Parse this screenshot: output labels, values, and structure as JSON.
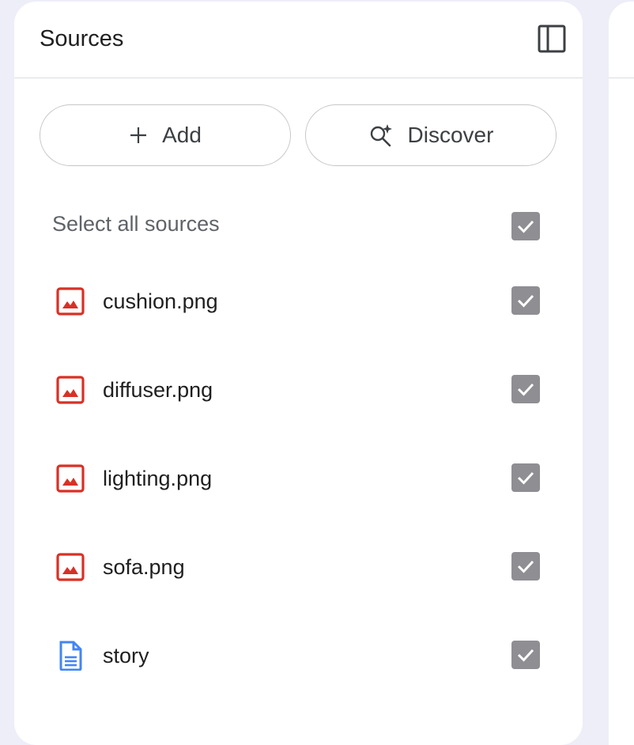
{
  "panel": {
    "title": "Sources"
  },
  "actions": {
    "add_label": "Add",
    "discover_label": "Discover"
  },
  "select_all": {
    "label": "Select all sources",
    "checked": true
  },
  "sources": [
    {
      "name": "cushion.png",
      "type": "image",
      "checked": true
    },
    {
      "name": "diffuser.png",
      "type": "image",
      "checked": true
    },
    {
      "name": "lighting.png",
      "type": "image",
      "checked": true
    },
    {
      "name": "sofa.png",
      "type": "image",
      "checked": true
    },
    {
      "name": "story",
      "type": "document",
      "checked": true
    }
  ],
  "colors": {
    "image_icon": "#d93025",
    "doc_icon": "#4285f4",
    "checkbox_fill": "#8e8e93",
    "background": "#eeeef8"
  }
}
